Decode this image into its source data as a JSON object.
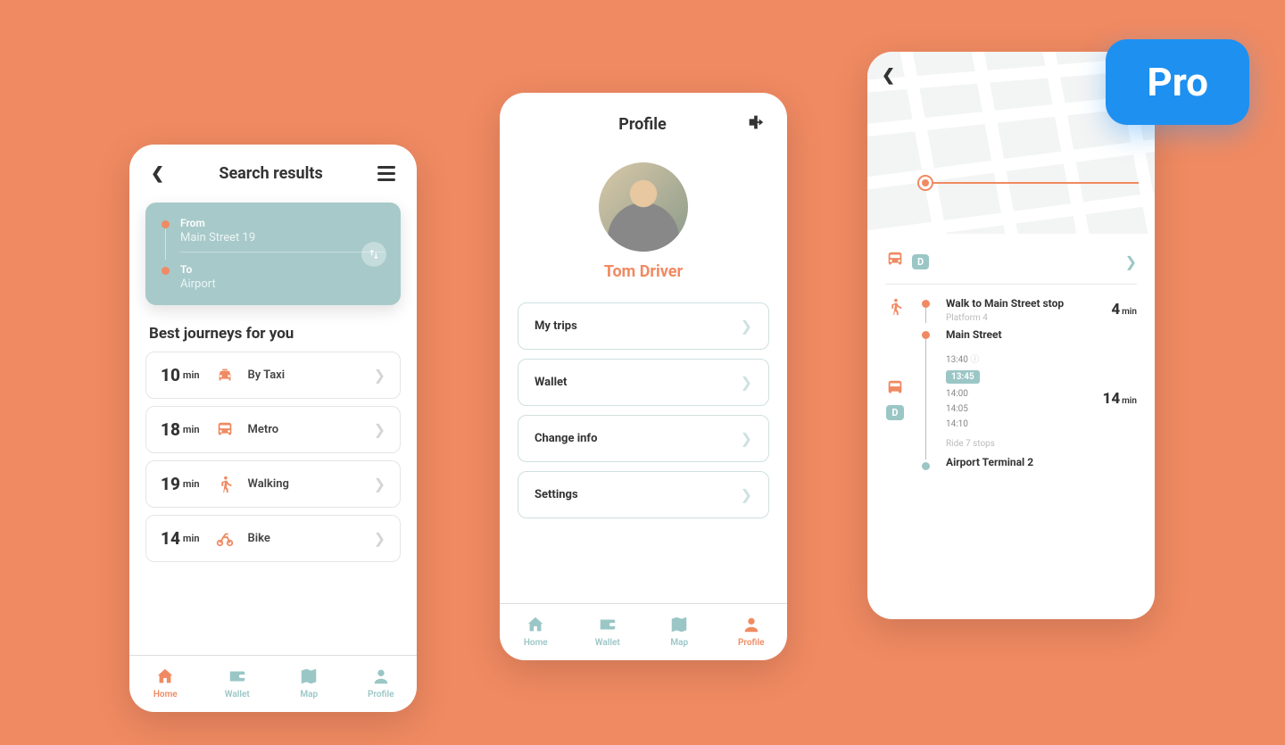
{
  "pro_label": "Pro",
  "screen1": {
    "title": "Search results",
    "from_label": "From",
    "from_value": "Main Street 19",
    "to_label": "To",
    "to_value": "Airport",
    "section": "Best journeys for you",
    "journeys": [
      {
        "time": "10",
        "unit": "min",
        "mode": "By Taxi",
        "icon": "taxi"
      },
      {
        "time": "18",
        "unit": "min",
        "mode": "Metro",
        "icon": "bus"
      },
      {
        "time": "19",
        "unit": "min",
        "mode": "Walking",
        "icon": "walk"
      },
      {
        "time": "14",
        "unit": "min",
        "mode": "Bike",
        "icon": "bike"
      }
    ],
    "nav": [
      {
        "label": "Home",
        "active": true
      },
      {
        "label": "Wallet",
        "active": false
      },
      {
        "label": "Map",
        "active": false
      },
      {
        "label": "Profile",
        "active": false
      }
    ]
  },
  "screen2": {
    "title": "Profile",
    "user_name": "Tom Driver",
    "menu": [
      {
        "label": "My trips"
      },
      {
        "label": "Wallet"
      },
      {
        "label": "Change info"
      },
      {
        "label": "Settings"
      }
    ],
    "nav": [
      {
        "label": "Home",
        "active": false
      },
      {
        "label": "Wallet",
        "active": false
      },
      {
        "label": "Map",
        "active": false
      },
      {
        "label": "Profile",
        "active": true
      }
    ]
  },
  "screen3": {
    "route_badge": "D",
    "steps": {
      "walk": {
        "title": "Walk to Main Street stop",
        "sub": "Platform 4",
        "time": "4",
        "unit": "min"
      },
      "bus": {
        "title": "Main Street",
        "badge": "D",
        "time": "14",
        "unit": "min"
      },
      "departures": [
        "13:40",
        "13:45",
        "14:00",
        "14:05",
        "14:10"
      ],
      "highlight_index": 1,
      "ride": "Ride 7 stops",
      "end": "Airport Terminal 2"
    }
  }
}
